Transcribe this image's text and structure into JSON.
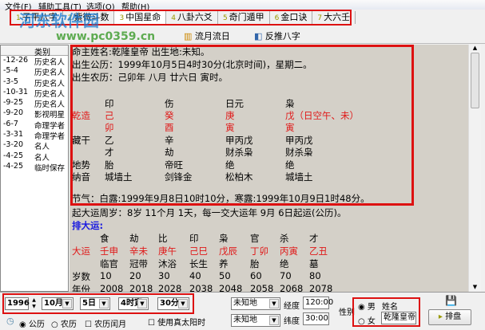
{
  "menu": [
    "文件(F)",
    "辅助工具(T)",
    "选项(O)",
    "帮助(H)"
  ],
  "tabs": [
    {
      "num": "1",
      "label": "子平八字"
    },
    {
      "num": "2",
      "label": "紫微斗数"
    },
    {
      "num": "3",
      "label": "中国星命"
    },
    {
      "num": "4",
      "label": "八卦六爻"
    },
    {
      "num": "5",
      "label": "奇门遁甲"
    },
    {
      "num": "6",
      "label": "金口诀"
    },
    {
      "num": "7",
      "label": "大六壬"
    }
  ],
  "toolbar2": {
    "liuyue": "流月流日",
    "fantui": "反推八字"
  },
  "watermark": {
    "name": "河东软件园",
    "url": "www.pc0359.cn"
  },
  "list": {
    "header": "类别",
    "rows": [
      [
        "-12-26",
        "历史名人"
      ],
      [
        "-5-4",
        "历史名人"
      ],
      [
        "-3-5",
        "历史名人"
      ],
      [
        "-10-31",
        "历史名人"
      ],
      [
        "-9-25",
        "历史名人"
      ],
      [
        "-9-20",
        "影视明星"
      ],
      [
        "-6-7",
        "命理学者"
      ],
      [
        "-3-31",
        "命理学者"
      ],
      [
        "-3-20",
        "名人"
      ],
      [
        "-4-25",
        "名人"
      ],
      [
        "-4-25",
        "临时保存"
      ]
    ]
  },
  "chart": {
    "line1": "命主姓名:乾隆皇帝   出生地:未知。",
    "line2": "出生公历：1999年10月5日4时30分(北京时间)，星期二。",
    "line3": "出生农历：己卯年 八月 廿六日 寅时。",
    "shishen": [
      "印",
      "伤",
      "日元",
      "枭"
    ],
    "qianzao": "乾造",
    "gan": [
      "己",
      "癸",
      "庚",
      "戊（日空午、未）"
    ],
    "zhi": [
      "卯",
      "酉",
      "寅",
      "寅"
    ],
    "canggan_label": "藏干",
    "canggan": [
      "乙",
      "辛",
      "甲丙戊",
      "甲丙戊"
    ],
    "canggan_ss": [
      "才",
      "劫",
      "财杀枭",
      "财杀枭"
    ],
    "dishi_label": "地势",
    "dishi": [
      "胎",
      "帝旺",
      "绝",
      "绝"
    ],
    "nayin_label": "纳音",
    "nayin": [
      "城墙土",
      "剑锋金",
      "松柏木",
      "城墙土"
    ],
    "jieqi": "节气：白露:1999年9月8日10时10分，寒露:1999年10月9日1时48分。",
    "qiyun": "起大运周岁：8岁 11个月 1天，每一交大运年 9月 6日起运(公历)。",
    "paidayun": "排大运:",
    "dy_ss": [
      "食",
      "劫",
      "比",
      "印",
      "枭",
      "官",
      "杀",
      "才"
    ],
    "dy_label": "大运",
    "dy": [
      "壬申",
      "辛未",
      "庚午",
      "己巳",
      "戊辰",
      "丁卯",
      "丙寅",
      "乙丑"
    ],
    "dy_cs": [
      "临官",
      "冠带",
      "沐浴",
      "长生",
      "养",
      "胎",
      "绝",
      "墓"
    ],
    "age_label": "岁数",
    "ages": [
      "10",
      "20",
      "30",
      "40",
      "50",
      "60",
      "70",
      "80"
    ],
    "year_label": "年份",
    "years": [
      "2008",
      "2018",
      "2028",
      "2038",
      "2048",
      "2058",
      "2068",
      "2078"
    ]
  },
  "bottom": {
    "year": "1996",
    "month": "10月",
    "day": "5日",
    "hour": "4时寅",
    "minute": "30分",
    "place1": "未知地",
    "place2": "未知地",
    "lng_label": "经度",
    "lng": "120:00",
    "lat_label": "纬度",
    "lat": "30:00",
    "gender_label": "性别",
    "male": "男",
    "female": "女",
    "name_label": "姓名",
    "name": "乾隆皇帝",
    "gongli": "公历",
    "nongli": "农历",
    "runyue": "农历闰月",
    "zty": "使用真太阳时",
    "paipan": "排盘"
  }
}
